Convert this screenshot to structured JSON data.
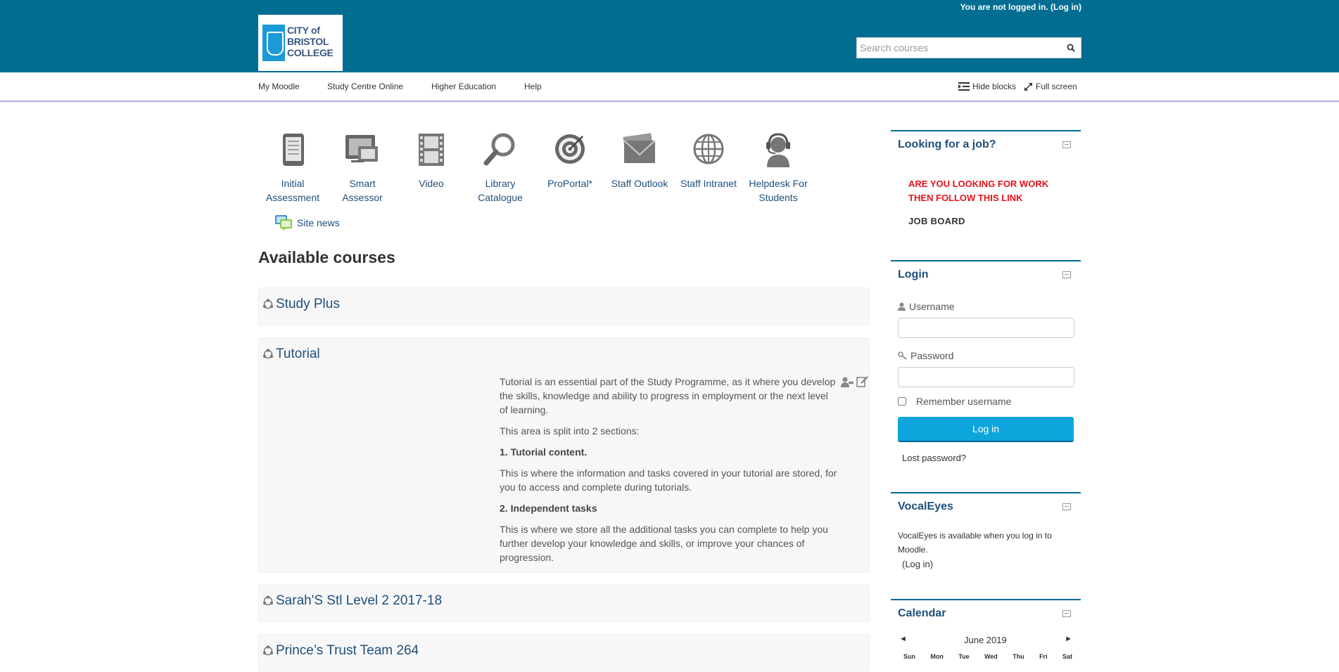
{
  "header": {
    "login_status": "You are not logged in. (Log in)",
    "logo_lines": [
      "CITY of",
      "BRISTOL",
      "COLLEGE"
    ],
    "search_placeholder": "Search courses",
    "brand_color": "#006d91"
  },
  "nav": {
    "items": [
      "My Moodle",
      "Study Centre Online",
      "Higher Education",
      "Help"
    ],
    "hide_blocks": "Hide blocks",
    "full_screen": "Full screen"
  },
  "quick_links": [
    {
      "label": "Initial\nAssessment",
      "icon": "document-icon"
    },
    {
      "label": "Smart\nAssessor",
      "icon": "monitor-icon"
    },
    {
      "label": "Video",
      "icon": "film-icon"
    },
    {
      "label": "Library\nCatalogue",
      "icon": "magnifier-icon"
    },
    {
      "label": "ProPortal*",
      "icon": "target-icon"
    },
    {
      "label": "Staff Outlook",
      "icon": "envelope-icon"
    },
    {
      "label": "Staff Intranet",
      "icon": "globe-icon"
    },
    {
      "label": "Helpdesk For\nStudents",
      "icon": "headset-icon"
    }
  ],
  "site_news": "Site news",
  "available_heading": "Available courses",
  "courses": [
    {
      "title": "Study Plus"
    },
    {
      "title": "Tutorial",
      "summary": {
        "p1": "Tutorial is an essential part of the Study Programme, as it where you develop the skills, knowledge and ability to progress in employment or the next level of learning.",
        "p2": "This area is split into 2 sections:",
        "h1": "1. Tutorial content.",
        "p3": "This is where the information and tasks covered in your tutorial are stored, for you to access and complete during tutorials.",
        "h2": "2. Independent tasks",
        "p4": "This is where we store all the additional tasks you can complete to help you further develop your knowledge and skills, or improve your chances of progression."
      }
    },
    {
      "title": "Sarah'S Stl Level 2 2017-18"
    },
    {
      "title": "Prince’s Trust Team 264"
    }
  ],
  "sidebar": {
    "job": {
      "title": "Looking for a job?",
      "red_text": "ARE YOU LOOKING FOR WORK THEN FOLLOW THIS LINK",
      "board": "JOB BOARD",
      "red_color": "#e5121b"
    },
    "login": {
      "title": "Login",
      "username_label": "Username",
      "password_label": "Password",
      "remember": "Remember username",
      "button": "Log in",
      "lost": "Lost password?",
      "button_color": "#0ea5dc"
    },
    "vocaleyes": {
      "title": "VocalEyes",
      "text": "VocalEyes is available when you log in to Moodle.",
      "login_link": "(Log in)"
    },
    "calendar": {
      "title": "Calendar",
      "month": "June 2019",
      "prev": "◄",
      "next": "►",
      "days": [
        "Sun",
        "Mon",
        "Tue",
        "Wed",
        "Thu",
        "Fri",
        "Sat"
      ]
    }
  }
}
